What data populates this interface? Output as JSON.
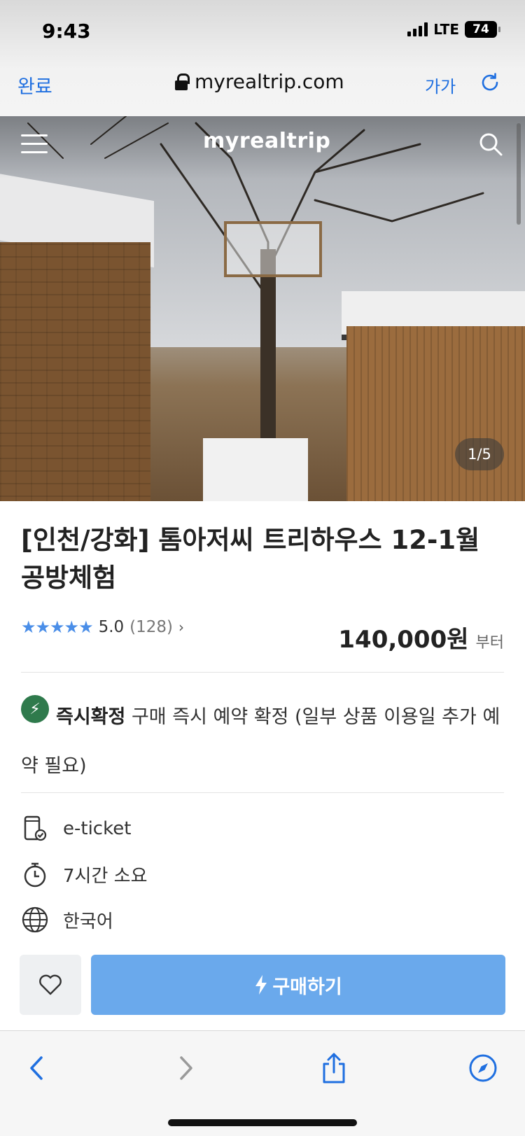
{
  "status_bar": {
    "time": "9:43",
    "network": "LTE",
    "battery": "74"
  },
  "browser": {
    "done_label": "완료",
    "url": "myrealtrip.com",
    "text_size_label": "가가"
  },
  "hero": {
    "brand": "myrealtrip",
    "image_counter": "1/5"
  },
  "product": {
    "title": "[인천/강화] 톰아저씨 트리하우스 12-1월 공방체험",
    "stars": "★★★★★",
    "rating": "5.0",
    "review_count": "(128)",
    "price": "140,000원",
    "price_suffix": "부터"
  },
  "instant_confirm": {
    "label": "즉시확정",
    "description": "구매 즉시 예약 확정 (일부 상품 이용일 추가 예약 필요)"
  },
  "info_items": [
    {
      "icon": "mobile-ticket-icon",
      "text": "e-ticket"
    },
    {
      "icon": "timer-icon",
      "text": "7시간 소요"
    },
    {
      "icon": "globe-icon",
      "text": "한국어"
    }
  ],
  "actions": {
    "buy_label": "구매하기"
  },
  "colors": {
    "accent": "#1f6fe0",
    "buy_button": "#6aa9ec",
    "instant_badge": "#2f7a4c",
    "stars": "#4a8ee8"
  }
}
